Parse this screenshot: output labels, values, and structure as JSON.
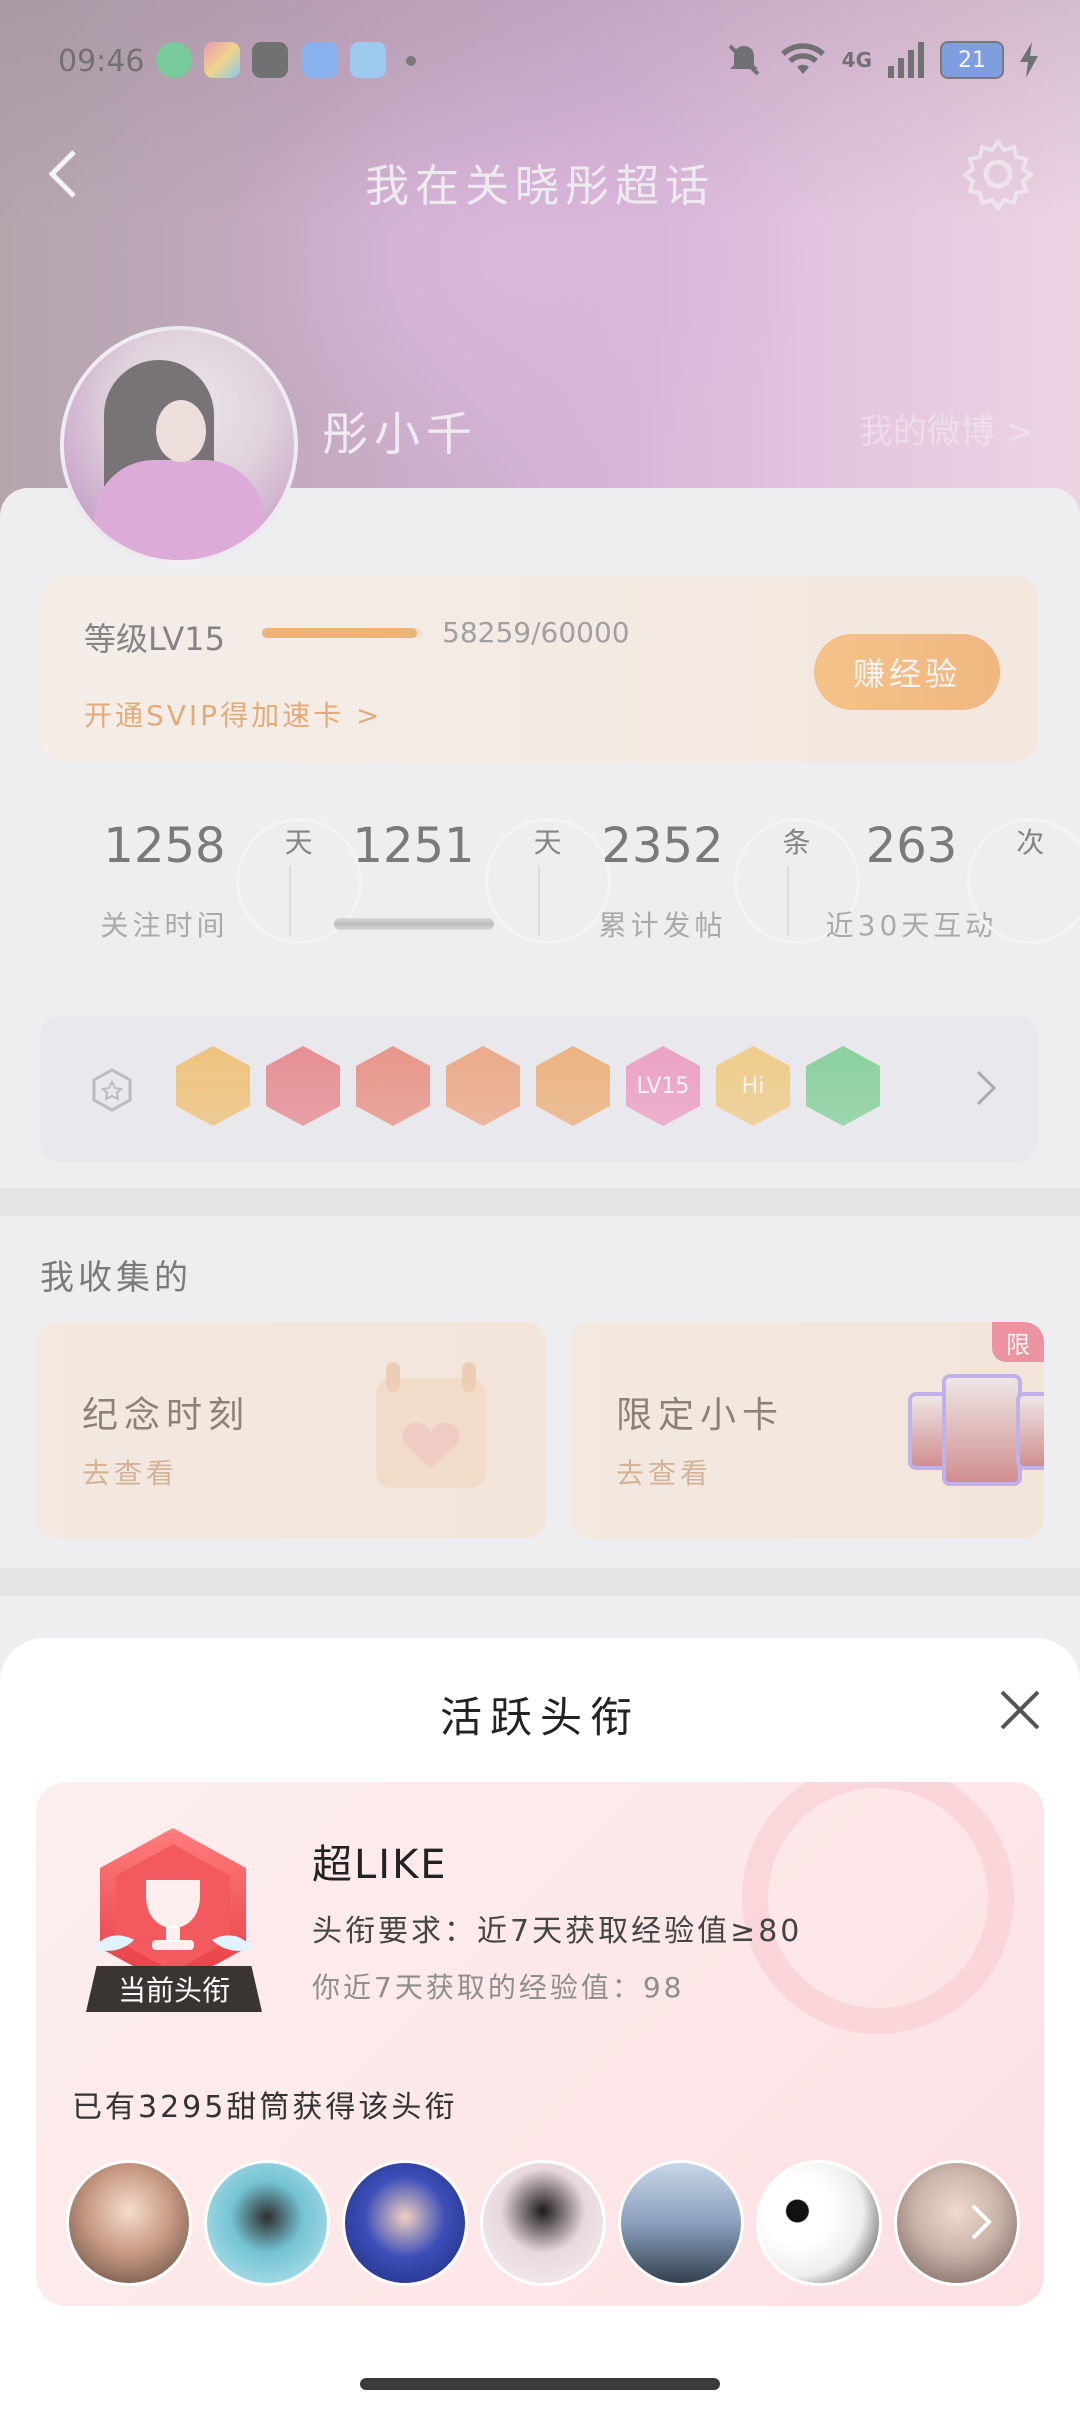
{
  "status_bar": {
    "time": "09:46",
    "network": "4G",
    "battery": "21"
  },
  "header": {
    "title": "我在关晓彤超话",
    "username": "彤小千",
    "my_weibo": "我的微博 >"
  },
  "level": {
    "label": "等级LV15",
    "progress_text": "58259/60000",
    "progress": 0.971,
    "svip_text": "开通SVIP得加速卡 >",
    "earn_button": "赚经验"
  },
  "stats": [
    {
      "value": "1258",
      "unit": "天",
      "label": "关注时间"
    },
    {
      "value": "1251",
      "unit": "天",
      "label": ""
    },
    {
      "value": "2352",
      "unit": "条",
      "label": "累计发帖"
    },
    {
      "value": "263",
      "unit": "次",
      "label": "近30天互动"
    }
  ],
  "badges": [
    {
      "icon": "crown-badge",
      "color": "#f5a623"
    },
    {
      "icon": "trophy-badge",
      "color": "#e5484d"
    },
    {
      "icon": "mascot-badge",
      "color": "#e9543a"
    },
    {
      "icon": "mascot-badge",
      "color": "#f07a3a"
    },
    {
      "icon": "dragon-badge",
      "color": "#f08a2a"
    },
    {
      "icon": "lv15-badge",
      "color": "#ef6aa6",
      "text": "LV15"
    },
    {
      "icon": "hi-badge",
      "color": "#f6b73c",
      "text": "Hi"
    },
    {
      "icon": "hand-badge",
      "color": "#3fbf5e"
    }
  ],
  "collections": {
    "title": "我收集的",
    "items": [
      {
        "title": "纪念时刻",
        "subtitle": "去查看"
      },
      {
        "title": "限定小卡",
        "subtitle": "去查看",
        "tag": "限"
      }
    ]
  },
  "sheet": {
    "title": "活跃头衔",
    "badge_name": "超LIKE",
    "current_tag": "当前头衔",
    "requirement": "头衔要求：近7天获取经验值≥80",
    "my_value": "你近7天获取的经验值：98",
    "holders_text": "已有3295甜筒获得该头衔"
  },
  "colors": {
    "accent": "#f08a1d",
    "badge_red": "#e5484d",
    "panel_pink": "#fdeeee"
  }
}
